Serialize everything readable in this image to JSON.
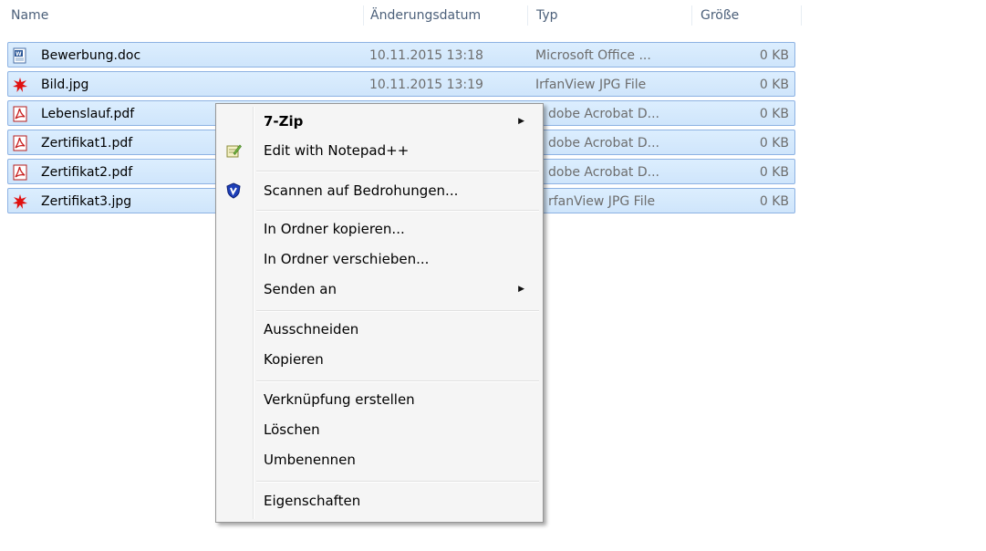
{
  "columns": {
    "name": "Name",
    "date": "Änderungsdatum",
    "type": "Typ",
    "size": "Größe"
  },
  "files": [
    {
      "name": "Bewerbung.doc",
      "date": "10.11.2015 13:18",
      "type": "Microsoft Office ...",
      "size": "0 KB",
      "icon": "word-doc-icon"
    },
    {
      "name": "Bild.jpg",
      "date": "10.11.2015 13:19",
      "type": "IrfanView JPG File",
      "size": "0 KB",
      "icon": "irfanview-jpg-icon"
    },
    {
      "name": "Lebenslauf.pdf",
      "date": "",
      "type": "dobe Acrobat D...",
      "size": "0 KB",
      "icon": "pdf-icon"
    },
    {
      "name": "Zertifikat1.pdf",
      "date": "",
      "type": "dobe Acrobat D...",
      "size": "0 KB",
      "icon": "pdf-icon"
    },
    {
      "name": "Zertifikat2.pdf",
      "date": "",
      "type": "dobe Acrobat D...",
      "size": "0 KB",
      "icon": "pdf-icon"
    },
    {
      "name": "Zertifikat3.jpg",
      "date": "",
      "type": "rfanView JPG File",
      "size": "0 KB",
      "icon": "irfanview-jpg-icon"
    }
  ],
  "context_menu": {
    "items": [
      {
        "label": "7-Zip",
        "bold": true,
        "submenu": true
      },
      {
        "label": "Edit with Notepad++",
        "icon": "notepad-plus-icon"
      },
      {
        "label": "Scannen auf Bedrohungen...",
        "icon": "shield-icon"
      },
      {
        "label": "In Ordner kopieren..."
      },
      {
        "label": "In Ordner verschieben..."
      },
      {
        "label": "Senden an",
        "submenu": true
      },
      {
        "label": "Ausschneiden"
      },
      {
        "label": "Kopieren"
      },
      {
        "label": "Verknüpfung erstellen"
      },
      {
        "label": "Löschen"
      },
      {
        "label": "Umbenennen"
      },
      {
        "label": "Eigenschaften"
      }
    ],
    "submenu_arrow": "▶"
  },
  "colors": {
    "selection_fill": "#cfe5fb",
    "selection_border": "#8db2e3",
    "header_text": "#4c607a",
    "menu_bg": "#f5f5f5"
  }
}
